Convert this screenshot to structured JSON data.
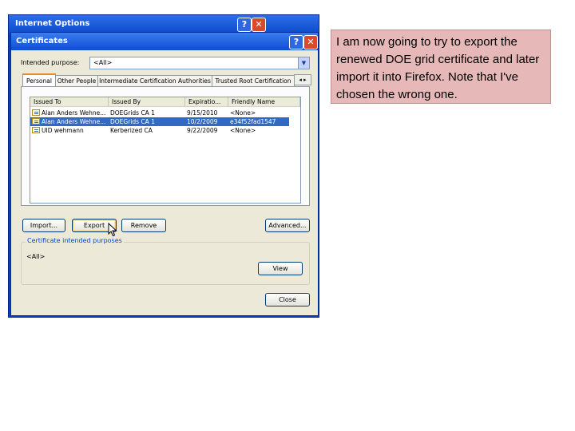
{
  "outer_window": {
    "title": "Internet Options",
    "help_label": "?",
    "close_label": "✕"
  },
  "dialog": {
    "title": "Certificates",
    "help_label": "?",
    "close_label": "✕",
    "purpose_label": "Intended purpose:",
    "purpose_value": "<All>",
    "tabs": [
      {
        "label": "Personal",
        "active": true
      },
      {
        "label": "Other People",
        "active": false
      },
      {
        "label": "Intermediate Certification Authorities",
        "active": false
      },
      {
        "label": "Trusted Root Certification",
        "active": false
      }
    ],
    "tab_scroll_label": "◂ ▸",
    "columns": [
      "Issued To",
      "Issued By",
      "Expiratio...",
      "Friendly Name"
    ],
    "rows": [
      {
        "issued_to": "Alan Anders Wehne...",
        "issued_by": "DOEGrids CA 1",
        "expiration": "9/15/2010",
        "friendly_name": "<None>",
        "selected": false
      },
      {
        "issued_to": "Alan Anders Wehne...",
        "issued_by": "DOEGrids CA 1",
        "expiration": "10/2/2009",
        "friendly_name": "e34f52fad1547",
        "selected": true
      },
      {
        "issued_to": "UID wehmann",
        "issued_by": "Kerberized CA",
        "expiration": "9/22/2009",
        "friendly_name": "<None>",
        "selected": false
      }
    ],
    "buttons": {
      "import": "Import...",
      "export": "Export",
      "remove": "Remove",
      "advanced": "Advanced...",
      "view": "View",
      "close": "Close"
    },
    "group_title": "Certificate intended purposes",
    "group_value": "<All>"
  },
  "note": "I am now going to try to export the renewed DOE grid certificate and later import it into Firefox.  Note that I've chosen the wrong one."
}
